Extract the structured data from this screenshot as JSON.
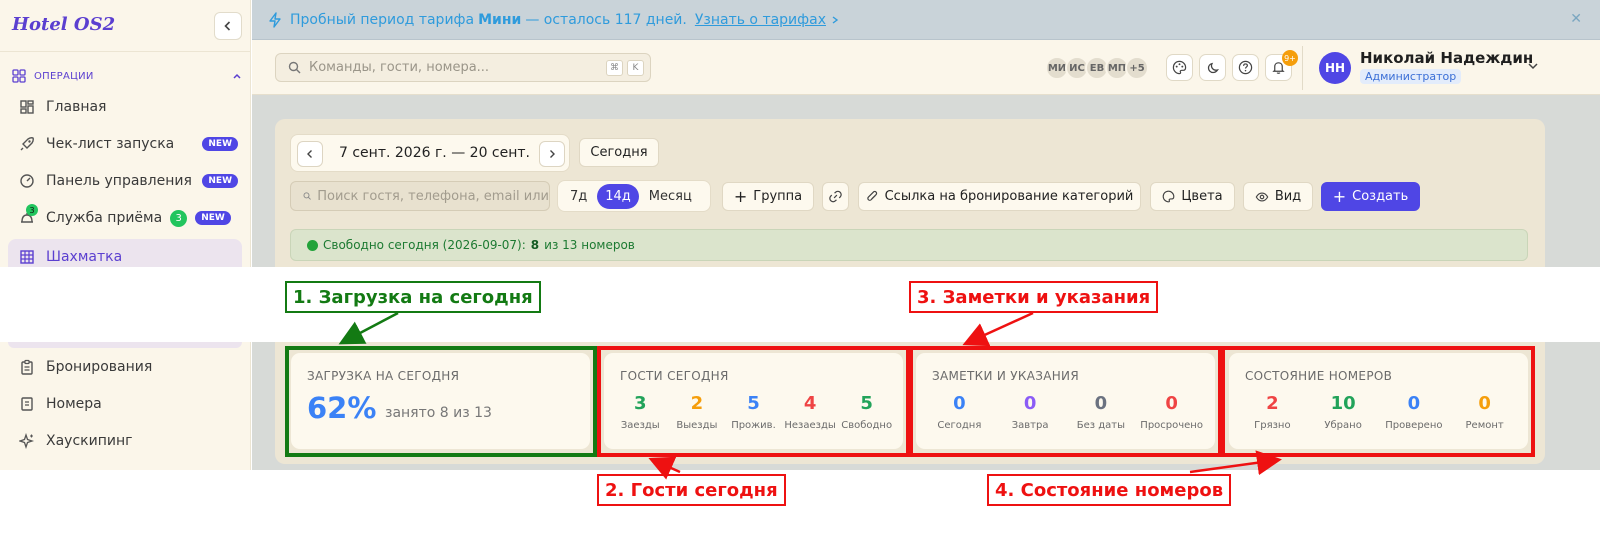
{
  "app": {
    "logo": "Hotel OS2"
  },
  "sidebar": {
    "section_label": "ОПЕРАЦИИ",
    "items": [
      {
        "label": "Главная",
        "icon": "dashboard-icon"
      },
      {
        "label": "Чек-лист запуска",
        "icon": "rocket-icon",
        "badge": "NEW"
      },
      {
        "label": "Панель управления",
        "icon": "gauge-icon",
        "badge": "NEW"
      },
      {
        "label": "Служба приёма",
        "icon": "bell-icon",
        "badge": "NEW",
        "count": "3",
        "icon_count": "3"
      },
      {
        "label": "Шахматка",
        "icon": "grid-icon",
        "active": true
      },
      {
        "label": "Бронирования",
        "icon": "clipboard-icon"
      },
      {
        "label": "Номера",
        "icon": "door-icon"
      },
      {
        "label": "Хаускипинг",
        "icon": "sparkle-icon"
      }
    ]
  },
  "banner": {
    "prefix": "Пробный период тарифа",
    "plan": "Мини",
    "rest": "— осталось 117 дней.",
    "link": "Узнать о тарифах",
    "close": "✕"
  },
  "topbar": {
    "search_placeholder": "Команды, гости, номера...",
    "kbd1": "⌘",
    "kbd2": "K",
    "avatars": [
      "МИ",
      "ИС",
      "ЕВ",
      "МП",
      "+5"
    ],
    "notif_badge": "9+",
    "user_initials": "НН",
    "user_name": "Николай Надеждин",
    "user_role": "Администратор"
  },
  "toolbar": {
    "date_range": "7 сент. 2026 г. — 20 сент.",
    "today": "Сегодня",
    "guest_search_placeholder": "Поиск гостя, телефона, email или",
    "seg": [
      "7д",
      "14д",
      "Месяц"
    ],
    "seg_selected": "14д",
    "group": "Группа",
    "booking_link": "Ссылка на бронирование категорий",
    "colors": "Цвета",
    "view": "Вид",
    "create": "Создать"
  },
  "status": {
    "prefix": "Свободно сегодня (2026-09-07):",
    "free": "8",
    "suffix": "из 13 номеров"
  },
  "cards": {
    "load": {
      "title": "ЗАГРУЗКА НА СЕГОДНЯ",
      "percent": "62%",
      "sub": "занято 8 из 13"
    },
    "guests": {
      "title": "ГОСТИ СЕГОДНЯ",
      "metrics": [
        {
          "value": "3",
          "label": "Заезды",
          "color": "#22a35a"
        },
        {
          "value": "2",
          "label": "Выезды",
          "color": "#f59e0b"
        },
        {
          "value": "5",
          "label": "Прожив.",
          "color": "#3b82f6"
        },
        {
          "value": "4",
          "label": "Незаезды",
          "color": "#ef4444"
        },
        {
          "value": "5",
          "label": "Свободно",
          "color": "#22a35a"
        }
      ]
    },
    "notes": {
      "title": "ЗАМЕТКИ И УКАЗАНИЯ",
      "metrics": [
        {
          "value": "0",
          "label": "Сегодня",
          "color": "#3b82f6"
        },
        {
          "value": "0",
          "label": "Завтра",
          "color": "#8b5cf6"
        },
        {
          "value": "0",
          "label": "Без даты",
          "color": "#6b7280"
        },
        {
          "value": "0",
          "label": "Просрочено",
          "color": "#ef4444"
        }
      ]
    },
    "rooms": {
      "title": "СОСТОЯНИЕ НОМЕРОВ",
      "metrics": [
        {
          "value": "2",
          "label": "Грязно",
          "color": "#ef4444"
        },
        {
          "value": "10",
          "label": "Убрано",
          "color": "#22a35a"
        },
        {
          "value": "0",
          "label": "Проверено",
          "color": "#3b82f6"
        },
        {
          "value": "0",
          "label": "Ремонт",
          "color": "#f59e0b"
        }
      ]
    }
  },
  "annotations": {
    "a1": "1. Загрузка на сегодня",
    "a2": "2. Гости сегодня",
    "a3": "3. Заметки и указания",
    "a4": "4. Состояние номеров"
  }
}
